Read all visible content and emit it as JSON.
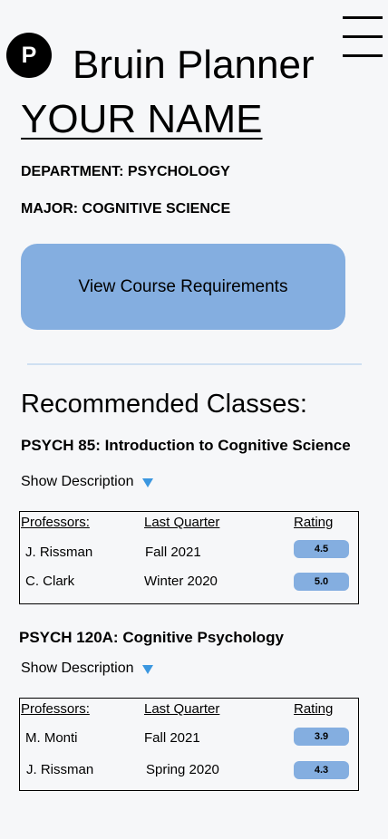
{
  "header": {
    "logo_letter": "P",
    "app_title": "Bruin Planner"
  },
  "profile": {
    "name": "YOUR NAME",
    "department": "DEPARTMENT: PSYCHOLOGY",
    "major": "MAJOR: COGNITIVE SCIENCE"
  },
  "actions": {
    "view_requirements": "View Course Requirements"
  },
  "recommended": {
    "title": "Recommended Classes:",
    "show_description_label": "Show Description",
    "table_headers": [
      "Professors:",
      "Last Quarter",
      "Rating"
    ],
    "courses": [
      {
        "title": "PSYCH 85: Introduction to Cognitive Science",
        "rows": [
          {
            "professor": "J. Rissman",
            "quarter": "Fall 2021",
            "rating": "4.5"
          },
          {
            "professor": "C. Clark",
            "quarter": "Winter 2020",
            "rating": "5.0"
          }
        ]
      },
      {
        "title": "PSYCH 120A: Cognitive Psychology",
        "rows": [
          {
            "professor": "M. Monti",
            "quarter": "Fall 2021",
            "rating": "3.9"
          },
          {
            "professor": "J. Rissman",
            "quarter": "Spring 2020",
            "rating": "4.3"
          }
        ]
      }
    ]
  },
  "colors": {
    "accent": "#84aee0",
    "triangle": "#3b97e0",
    "background": "#f6f7f9"
  }
}
